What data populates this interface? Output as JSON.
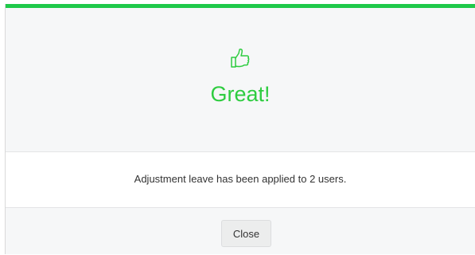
{
  "modal": {
    "title": "Great!",
    "icon": "thumbs-up-icon",
    "message": "Adjustment leave has been applied to 2 users.",
    "close_label": "Close"
  },
  "colors": {
    "accent": "#1fc94a",
    "title_text": "#2ecc40",
    "icon_stroke": "#2ecc40"
  }
}
